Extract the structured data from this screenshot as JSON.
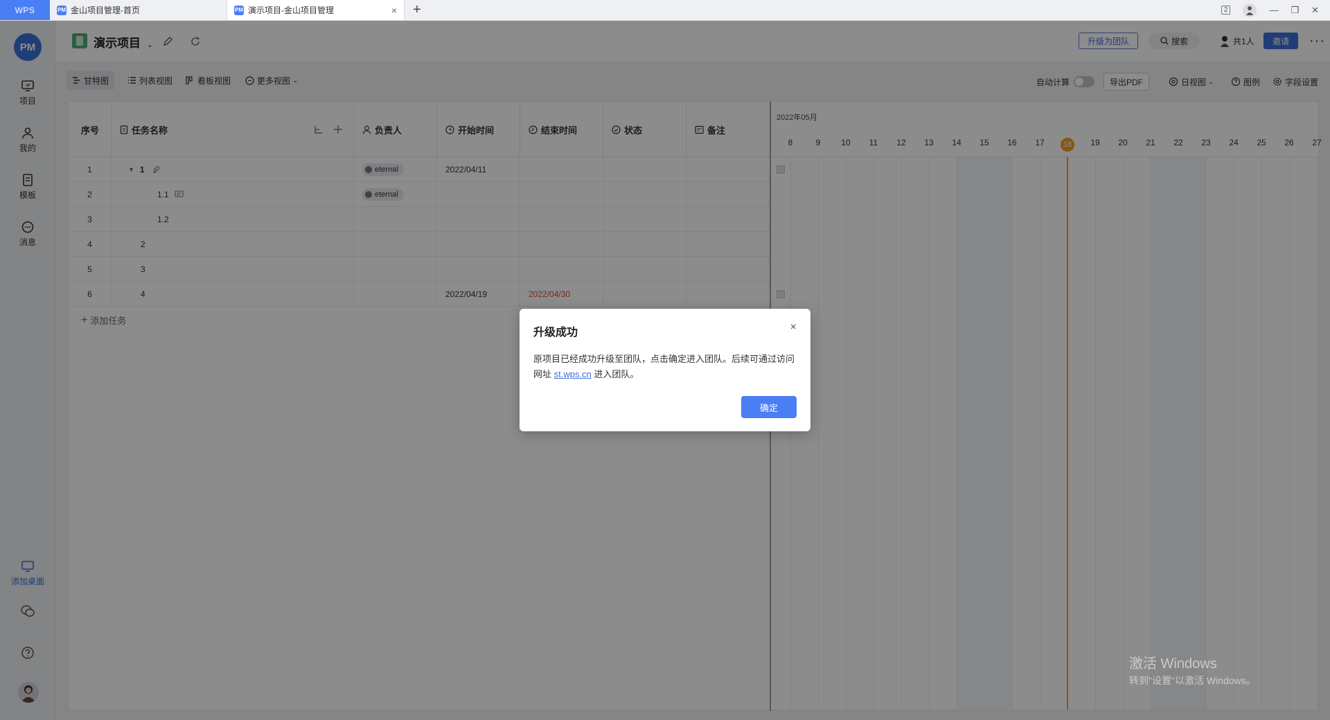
{
  "titlebar": {
    "app_label": "WPS",
    "tabs": [
      {
        "label": "金山项目管理-首页",
        "active": false,
        "favicon": "pm-icon"
      },
      {
        "label": "演示项目-金山项目管理",
        "active": true,
        "favicon": "pm-icon"
      }
    ],
    "new_tab_label": "+",
    "window_badge": "2"
  },
  "sidebar": {
    "logo": "PM",
    "items": [
      {
        "label": "项目",
        "icon": "monitor-icon"
      },
      {
        "label": "我的",
        "icon": "user-icon"
      },
      {
        "label": "模板",
        "icon": "template-icon"
      },
      {
        "label": "消息",
        "icon": "message-icon"
      }
    ],
    "add_desktop": "添加桌面"
  },
  "header": {
    "title": "演示项目",
    "upgrade_label": "升级为团队",
    "search_label": "搜索",
    "people_label": "共1人",
    "invite_label": "邀请",
    "more_label": "···"
  },
  "toolbar": {
    "views": [
      "甘特图",
      "列表视图",
      "看板视图",
      "更多视图"
    ],
    "auto_calc": "自动计算",
    "export_pdf": "导出PDF",
    "day_view": "日视图",
    "legend": "图例",
    "field_settings": "字段设置"
  },
  "table": {
    "columns": [
      "序号",
      "任务名称",
      "负责人",
      "开始时间",
      "结束时间",
      "状态",
      "备注"
    ],
    "rows": [
      {
        "idx": "1",
        "name": "1",
        "assignee": "eternal",
        "start": "2022/04/11",
        "end": ""
      },
      {
        "idx": "2",
        "name": "1.1",
        "assignee": "eternal",
        "start": "",
        "end": ""
      },
      {
        "idx": "3",
        "name": "1.2",
        "assignee": "",
        "start": "",
        "end": ""
      },
      {
        "idx": "4",
        "name": "2",
        "assignee": "",
        "start": "",
        "end": ""
      },
      {
        "idx": "5",
        "name": "3",
        "assignee": "",
        "start": "",
        "end": ""
      },
      {
        "idx": "6",
        "name": "4",
        "assignee": "",
        "start": "2022/04/19",
        "end": "2022/04/30"
      }
    ],
    "add_task": "添加任务"
  },
  "gantt": {
    "month": "2022年05月",
    "days": [
      "8",
      "9",
      "10",
      "11",
      "12",
      "13",
      "14",
      "15",
      "16",
      "17",
      "18",
      "19",
      "20",
      "21",
      "22",
      "23",
      "24",
      "25",
      "26",
      "27"
    ],
    "today": "18",
    "today_color": "#f0a020"
  },
  "dialog": {
    "title": "升级成功",
    "close": "×",
    "body_before": "原项目已经成功升级至团队，点击确定进入团队。后续可通过访问网址 ",
    "link": "st.wps.cn",
    "body_after": " 进入团队。",
    "ok": "确定"
  },
  "watermark": {
    "line1": "激活 Windows",
    "line2": "转到\"设置\"以激活 Windows。"
  },
  "colors": {
    "accent": "#4a7ef5",
    "brand": "#3c6fd9",
    "overdue": "#d9453d"
  }
}
